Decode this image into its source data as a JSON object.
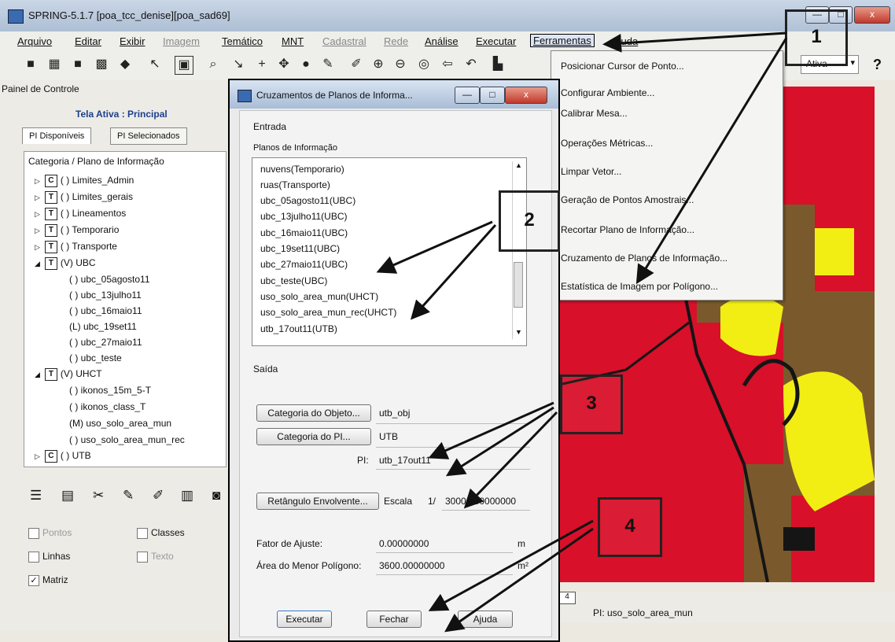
{
  "window": {
    "title": "SPRING-5.1.7 [poa_tcc_denise][poa_sad69]",
    "min": "—",
    "max": "□",
    "close": "x"
  },
  "menubar": [
    "Arquivo",
    "Editar",
    "Exibir",
    "Imagem",
    "Temático",
    "MNT",
    "Cadastral",
    "Rede",
    "Análise",
    "Executar",
    "Ferramentas",
    "Ajuda"
  ],
  "toolbar": {
    "combo": "Ativa",
    "help": "?"
  },
  "panel": {
    "title": "Painel de Controle",
    "tela": "Tela Ativa : Principal",
    "tab1": "PI Disponíveis",
    "tab2": "PI Selecionados",
    "tree_header": "Categoria / Plano de Informação",
    "tree": [
      {
        "box": "C",
        "label": "( ) Limites_Admin"
      },
      {
        "box": "T",
        "label": "( ) Limites_gerais"
      },
      {
        "box": "T",
        "label": "( ) Lineamentos"
      },
      {
        "box": "T",
        "label": "( ) Temporario"
      },
      {
        "box": "T",
        "label": "( ) Transporte"
      },
      {
        "box": "T",
        "label": "(V) UBC"
      },
      {
        "label": "( ) ubc_05agosto11"
      },
      {
        "label": "( ) ubc_13julho11"
      },
      {
        "label": "( ) ubc_16maio11"
      },
      {
        "label": "(L) ubc_19set11"
      },
      {
        "label": "( ) ubc_27maio11"
      },
      {
        "label": "( ) ubc_teste"
      },
      {
        "box": "T",
        "label": "(V) UHCT"
      },
      {
        "label": "( ) ikonos_15m_5-T"
      },
      {
        "label": "( ) ikonos_class_T"
      },
      {
        "label": "(M) uso_solo_area_mun"
      },
      {
        "label": "( ) uso_solo_area_mun_rec"
      },
      {
        "box": "C",
        "label": "( ) UTB"
      }
    ],
    "opts": {
      "pontos": "Pontos",
      "classes": "Classes",
      "linhas": "Linhas",
      "texto": "Texto",
      "matriz": "Matriz",
      "check": "✓"
    }
  },
  "dropdown": [
    "Posicionar Cursor de Ponto...",
    "Configurar Ambiente...",
    "Calibrar Mesa...",
    "Operações Métricas...",
    "Limpar Vetor...",
    "Geração de Pontos Amostrais...",
    "Recortar Plano de Informação...",
    "Cruzamento de Planos de Informação...",
    "Estatística de Imagem por Polígono..."
  ],
  "dialog": {
    "title": "Cruzamentos de Planos de Informa...",
    "entrada": "Entrada",
    "planos_label": "Planos de Informação",
    "planos": [
      "nuvens(Temporario)",
      "ruas(Transporte)",
      "ubc_05agosto11(UBC)",
      "ubc_13julho11(UBC)",
      "ubc_16maio11(UBC)",
      "ubc_19set11(UBC)",
      "ubc_27maio11(UBC)",
      "ubc_teste(UBC)",
      "uso_solo_area_mun(UHCT)",
      "uso_solo_area_mun_rec(UHCT)",
      "utb_17out11(UTB)"
    ],
    "saida": "Saída",
    "btn_cat_obj": "Categoria do Objeto...",
    "val_cat_obj": "utb_obj",
    "btn_cat_pi": "Categoria do PI...",
    "val_cat_pi": "UTB",
    "pi_label": "PI:",
    "pi_value": "utb_17out11",
    "btn_ret": "Retângulo Envolvente...",
    "escala_label": "Escala",
    "escala_sep": "1/",
    "escala_value": "30000.00000000",
    "fator_label": "Fator de Ajuste:",
    "fator_value": "0.00000000",
    "fator_unit": "m",
    "area_label": "Área do Menor Polígono:",
    "area_value": "3600.00000000",
    "area_unit": "m²",
    "btn_exec": "Executar",
    "btn_fechar": "Fechar",
    "btn_ajuda": "Ajuda"
  },
  "map": {
    "pi_status": "PI: uso_solo_area_mun",
    "tab": "4"
  },
  "callouts": [
    "1",
    "2",
    "3",
    "4"
  ],
  "colors": {
    "red": "#d8102a",
    "yellow": "#f2ee14",
    "brown": "#7a5a2c",
    "black": "#151515"
  }
}
